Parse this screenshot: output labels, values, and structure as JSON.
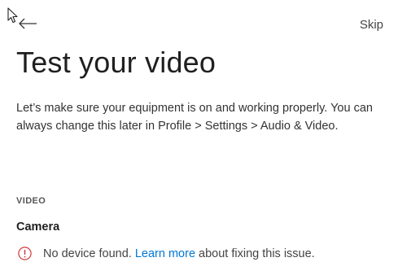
{
  "header": {
    "skip_label": "Skip"
  },
  "main": {
    "title": "Test your video",
    "description": "Let’s make sure your equipment is on and working properly. You can always change this later in Profile > Settings > Audio & Video.",
    "section_label": "VIDEO",
    "field_title": "Camera",
    "error": {
      "prefix": "No device found.",
      "link": "Learn more",
      "suffix": "about fixing this issue."
    }
  },
  "icons": {
    "back": "arrow-left-icon",
    "error": "alert-circle-icon",
    "cursor": "mouse-pointer-icon"
  },
  "colors": {
    "link": "#0078d4",
    "error": "#d13438"
  }
}
